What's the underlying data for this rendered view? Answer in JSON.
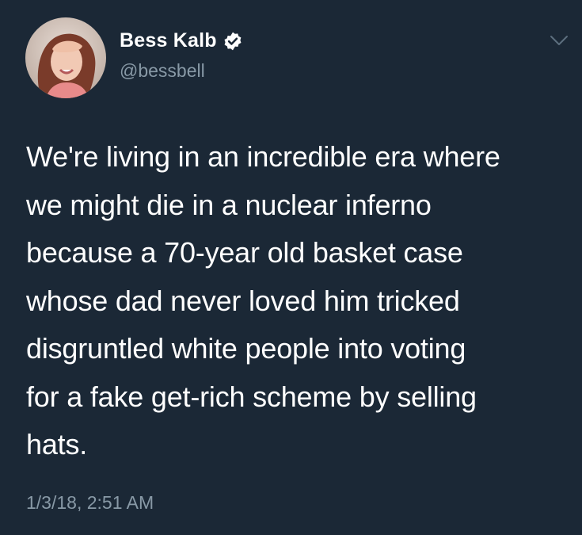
{
  "author": {
    "display_name": "Bess Kalb",
    "handle": "@bessbell",
    "verified": true,
    "avatar_icon": "profile-photo"
  },
  "tweet": {
    "lines": [
      "We're living in an incredible era where",
      "we might die in a nuclear inferno",
      "because a 70-year old basket case",
      "whose dad never loved him tricked",
      "disgruntled white people into voting",
      "for a fake get-rich scheme by selling",
      "hats."
    ],
    "timestamp": "1/3/18, 2:51 AM"
  },
  "colors": {
    "background": "#1b2836",
    "text": "#ffffff",
    "secondary_text": "#8899a6",
    "verified_badge": "#ffffff"
  },
  "menu_icon": "chevron-down-icon"
}
